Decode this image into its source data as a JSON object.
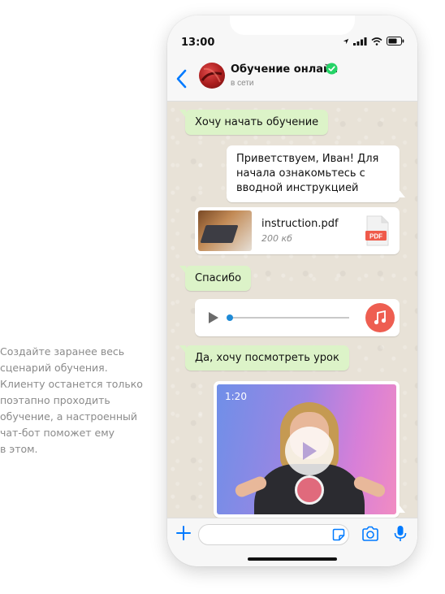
{
  "side_text": "Создайте заранее весь\nсценарий обучения.\nКлиенту останется только\nпоэтапно проходить\nобучение, а настроенный\nчат-бот поможет ему\nв этом.",
  "status_bar": {
    "time": "13:00"
  },
  "header": {
    "name": "Обучение онлайн",
    "status": "в сети"
  },
  "messages": {
    "m1": "Хочу начать обучение",
    "m2": "Приветствуем, Иван! Для начала ознакомьтесь с вводной инструкцией",
    "file": {
      "name": "instruction.pdf",
      "size": "200 кб",
      "icon_label": "PDF"
    },
    "m4": "Спасибо",
    "audio": {
      "progress": 0.02
    },
    "m6": "Да, хочу посмотреть урок",
    "video": {
      "duration": "1:20"
    }
  },
  "colors": {
    "outgoing": "#dcf3c8",
    "accent": "#007aff",
    "verified": "#25d366",
    "music": "#ee5e51"
  }
}
